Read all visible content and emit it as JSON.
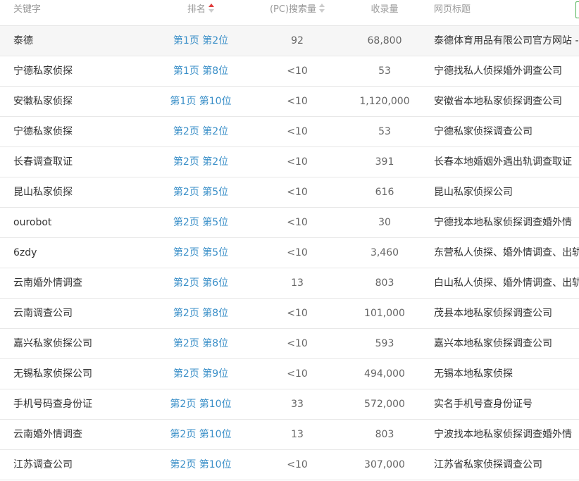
{
  "header": {
    "keyword": "关键字",
    "rank": "排名",
    "pc_search": "(PC)搜索量",
    "indexed": "收录量",
    "title": "网页标题"
  },
  "rows": [
    {
      "keyword": "泰德",
      "rank": "第1页 第2位",
      "pc": "92",
      "indexed": "68,800",
      "title": "泰德体育用品有限公司官方网站 -"
    },
    {
      "keyword": "宁德私家侦探",
      "rank": "第1页 第8位",
      "pc": "<10",
      "indexed": "53",
      "title": "宁德找私人侦探婚外调查公司"
    },
    {
      "keyword": "安徽私家侦探",
      "rank": "第1页 第10位",
      "pc": "<10",
      "indexed": "1,120,000",
      "title": "安徽省本地私家侦探调查公司"
    },
    {
      "keyword": "宁德私家侦探",
      "rank": "第2页 第2位",
      "pc": "<10",
      "indexed": "53",
      "title": "宁德私家侦探调查公司"
    },
    {
      "keyword": "长春调查取证",
      "rank": "第2页 第2位",
      "pc": "<10",
      "indexed": "391",
      "title": "长春本地婚姻外遇出轨调查取证"
    },
    {
      "keyword": "昆山私家侦探",
      "rank": "第2页 第5位",
      "pc": "<10",
      "indexed": "616",
      "title": "昆山私家侦探公司"
    },
    {
      "keyword": "ourobot",
      "rank": "第2页 第5位",
      "pc": "<10",
      "indexed": "30",
      "title": "宁德找本地私家侦探调查婚外情"
    },
    {
      "keyword": "6zdy",
      "rank": "第2页 第5位",
      "pc": "<10",
      "indexed": "3,460",
      "title": "东营私人侦探、婚外情调查、出轨"
    },
    {
      "keyword": "云南婚外情调查",
      "rank": "第2页 第6位",
      "pc": "13",
      "indexed": "803",
      "title": "白山私人侦探、婚外情调查、出轨"
    },
    {
      "keyword": "云南调查公司",
      "rank": "第2页 第8位",
      "pc": "<10",
      "indexed": "101,000",
      "title": "茂县本地私家侦探调查公司"
    },
    {
      "keyword": "嘉兴私家侦探公司",
      "rank": "第2页 第8位",
      "pc": "<10",
      "indexed": "593",
      "title": "嘉兴本地私家侦探调查公司"
    },
    {
      "keyword": "无锡私家侦探公司",
      "rank": "第2页 第9位",
      "pc": "<10",
      "indexed": "494,000",
      "title": "无锡本地私家侦探"
    },
    {
      "keyword": "手机号码查身份证",
      "rank": "第2页 第10位",
      "pc": "33",
      "indexed": "572,000",
      "title": "实名手机号查身份证号"
    },
    {
      "keyword": "云南婚外情调查",
      "rank": "第2页 第10位",
      "pc": "13",
      "indexed": "803",
      "title": "宁波找本地私家侦探调查婚外情"
    },
    {
      "keyword": "江苏调查公司",
      "rank": "第2页 第10位",
      "pc": "<10",
      "indexed": "307,000",
      "title": "江苏省私家侦探调查公司"
    }
  ],
  "colors": {
    "rank_link": "#3a8fc8",
    "sort_active": "#e03c3c",
    "header_text": "#999999",
    "first_row_bg": "#f6f6f6",
    "checkbox_border": "#4caf50"
  }
}
